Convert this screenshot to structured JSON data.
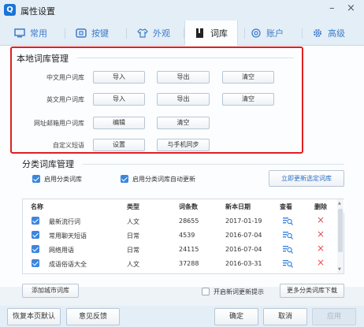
{
  "window": {
    "title": "属性设置",
    "logo": "Q",
    "minimize": "–",
    "close": "×"
  },
  "tabs": [
    {
      "label": "常用",
      "icon": "monitor-icon"
    },
    {
      "label": "按键",
      "icon": "key-icon"
    },
    {
      "label": "外观",
      "icon": "shirt-icon"
    },
    {
      "label": "词库",
      "icon": "book-icon"
    },
    {
      "label": "账户",
      "icon": "account-icon"
    },
    {
      "label": "高级",
      "icon": "gear-icon"
    }
  ],
  "local_dict": {
    "title": "本地词库管理",
    "rows": [
      {
        "label": "中文用户词库",
        "buttons": [
          "导入",
          "导出",
          "清空"
        ]
      },
      {
        "label": "英文用户词库",
        "buttons": [
          "导入",
          "导出",
          "清空"
        ]
      },
      {
        "label": "网址邮箱用户词库",
        "buttons": [
          "编辑",
          "清空"
        ]
      },
      {
        "label": "自定义短语",
        "buttons": [
          "设置",
          "与手机同步"
        ]
      }
    ]
  },
  "category_dict": {
    "title": "分类词库管理",
    "enable_label": "启用分类词库",
    "enable_checked": true,
    "auto_update_label": "启用分类词库自动更新",
    "auto_update_checked": true,
    "update_now_button": "立即更新选定词库",
    "columns": [
      "名称",
      "类型",
      "词条数",
      "新本日期",
      "查看",
      "删除"
    ],
    "rows": [
      {
        "checked": true,
        "name": "最新流行词",
        "type": "人文",
        "count": "28655",
        "date": "2017-01-19"
      },
      {
        "checked": true,
        "name": "常用聊天短语",
        "type": "日常",
        "count": "4539",
        "date": "2016-07-04"
      },
      {
        "checked": true,
        "name": "网络用语",
        "type": "日常",
        "count": "24115",
        "date": "2016-07-04"
      },
      {
        "checked": true,
        "name": "成语俗语大全",
        "type": "人文",
        "count": "37288",
        "date": "2016-03-31"
      }
    ],
    "add_city_button": "添加城市词库",
    "new_dict_tip_label": "开启新词更新提示",
    "new_dict_tip_checked": false,
    "more_download_button": "更多分类词库下载"
  },
  "footer": {
    "restore_button": "恢复本页默认",
    "feedback_button": "意见反馈",
    "ok_button": "确定",
    "cancel_button": "取消",
    "apply_button": "应用"
  },
  "colors": {
    "accent": "#3b86de",
    "highlight_box": "#e02020",
    "delete": "#e35050"
  }
}
